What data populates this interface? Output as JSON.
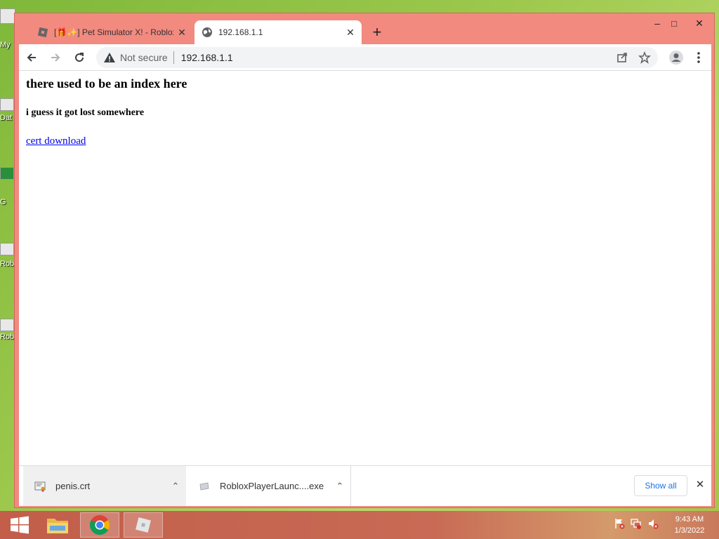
{
  "desktop": {
    "icons": [
      {
        "label": "My"
      },
      {
        "label": "Dat"
      },
      {
        "label": "G"
      },
      {
        "label": "Rob"
      },
      {
        "label": "Rob"
      }
    ]
  },
  "window": {
    "controls": {
      "minimize": "–",
      "maximize": "□",
      "close": "✕"
    }
  },
  "tabs": [
    {
      "title": "[🎁✨] Pet Simulator X! - Roblox",
      "close": "✕"
    },
    {
      "title": "192.168.1.1",
      "close": "✕"
    }
  ],
  "new_tab": "+",
  "omnibox": {
    "security_label": "Not secure",
    "url": "192.168.1.1"
  },
  "page": {
    "heading": "there used to be an index here",
    "subheading": "i guess it got lost somewhere",
    "link": "cert download"
  },
  "downloads": {
    "items": [
      {
        "name": "penis.crt",
        "chevron": "⌃"
      },
      {
        "name": "RobloxPlayerLaunc....exe",
        "chevron": "⌃"
      }
    ],
    "show_all": "Show all",
    "close": "✕"
  },
  "clock": {
    "time": "9:43 AM",
    "date": "1/3/2022"
  },
  "colors": {
    "window_frame": "#f28a80",
    "link": "#0000ee",
    "accent": "#1a73e8"
  }
}
